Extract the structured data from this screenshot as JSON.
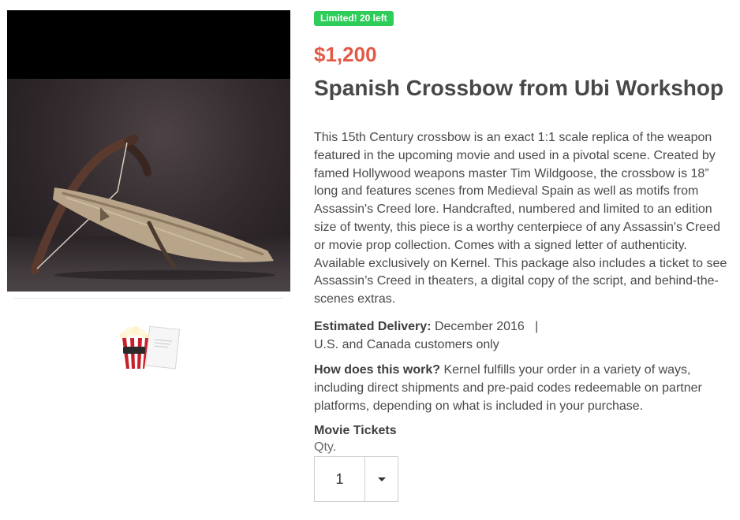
{
  "badge": "Limited! 20 left",
  "price": "$1,200",
  "title": "Spanish Crossbow from Ubi Workshop",
  "description": "This 15th Century crossbow is an exact 1:1 scale replica of the weapon featured in the upcoming movie and used in a pivotal scene. Created by famed Hollywood weapons master Tim Wildgoose, the crossbow is 18” long and features scenes from Medieval Spain as well as motifs from Assassin's Creed lore. Handcrafted, numbered and limited to an edition size of twenty, this piece is a worthy centerpiece of any Assassin's Creed or movie prop collection. Comes with a signed letter of authenticity. Available exclusively on Kernel. This package also includes a ticket to see Assassin’s Creed in theaters, a digital copy of the script, and behind-the-scenes extras.",
  "delivery": {
    "label": "Estimated Delivery:",
    "value": "December 2016",
    "separator": "|",
    "note": "U.S. and Canada customers only"
  },
  "how": {
    "label": "How does this work?",
    "text": "Kernel fulfills your order in a variety of ways, including direct shipments and pre-paid codes redeemable on partner platforms, depending on what is included in your purchase."
  },
  "option": {
    "label": "Movie Tickets",
    "qty_label": "Qty.",
    "qty_value": "1"
  },
  "colors": {
    "badge": "#2ecc59",
    "price": "#e25a45"
  },
  "icons": {
    "thumbnail": "popcorn-and-script-icon",
    "dropdown": "caret-down-icon"
  }
}
